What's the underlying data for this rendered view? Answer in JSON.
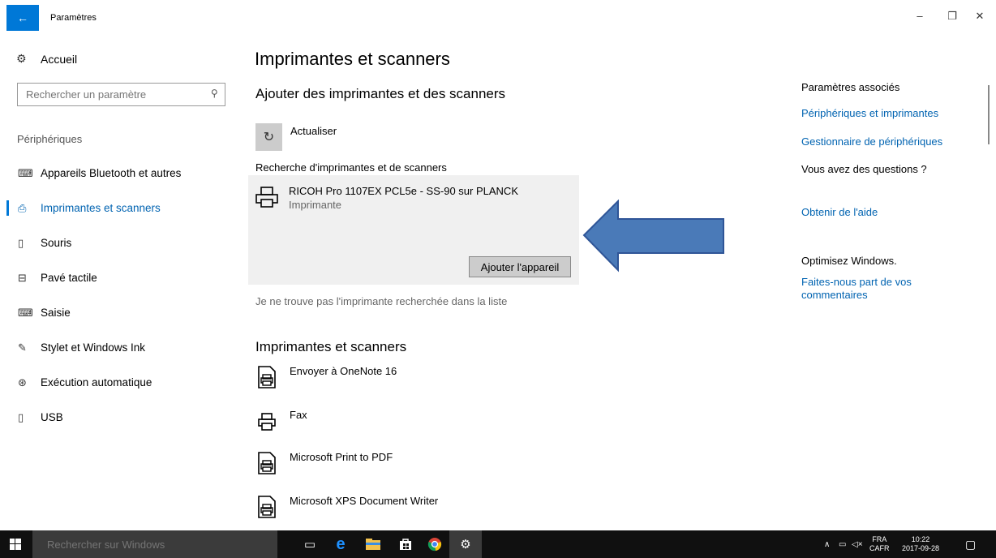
{
  "window": {
    "title": "Paramètres",
    "back_icon": "←",
    "minimize": "–",
    "restore": "❐",
    "close": "✕"
  },
  "sidebar": {
    "home_label": "Accueil",
    "search_placeholder": "Rechercher un paramètre",
    "section_label": "Périphériques",
    "items": [
      {
        "label": "Appareils Bluetooth et autres",
        "icon": "bluetooth-devices-icon",
        "glyph": "⌨"
      },
      {
        "label": "Imprimantes et scanners",
        "icon": "printer-icon",
        "glyph": "⎙"
      },
      {
        "label": "Souris",
        "icon": "mouse-icon",
        "glyph": "▯"
      },
      {
        "label": "Pavé tactile",
        "icon": "touchpad-icon",
        "glyph": "⊟"
      },
      {
        "label": "Saisie",
        "icon": "keyboard-icon",
        "glyph": "⌨"
      },
      {
        "label": "Stylet et Windows Ink",
        "icon": "pen-icon",
        "glyph": "✎"
      },
      {
        "label": "Exécution automatique",
        "icon": "autoplay-icon",
        "glyph": "⊛"
      },
      {
        "label": "USB",
        "icon": "usb-icon",
        "glyph": "▯"
      }
    ],
    "active_index": 1
  },
  "main": {
    "page_title": "Imprimantes et scanners",
    "add_section_title": "Ajouter des imprimantes et des scanners",
    "refresh_label": "Actualiser",
    "searching_text": "Recherche d'imprimantes et de scanners",
    "found_device": {
      "name": "RICOH Pro 1107EX PCL5e - SS-90 sur PLANCK",
      "type": "Imprimante",
      "add_button": "Ajouter l'appareil"
    },
    "not_found_link": "Je ne trouve pas l'imprimante recherchée dans la liste",
    "printers_section_title": "Imprimantes et scanners",
    "printers": [
      {
        "name": "Envoyer à OneNote 16",
        "icon": "document-printer-icon"
      },
      {
        "name": "Fax",
        "icon": "fax-printer-icon"
      },
      {
        "name": "Microsoft Print to PDF",
        "icon": "document-printer-icon"
      },
      {
        "name": "Microsoft XPS Document Writer",
        "icon": "document-printer-icon"
      }
    ]
  },
  "right_panel": {
    "related_heading": "Paramètres associés",
    "related_links": [
      "Périphériques et imprimantes",
      "Gestionnaire de périphériques"
    ],
    "questions_heading": "Vous avez des questions ?",
    "help_link": "Obtenir de l'aide",
    "improve_heading": "Optimisez Windows.",
    "feedback_link": "Faites-nous part de vos commentaires"
  },
  "taskbar": {
    "search_placeholder": "Rechercher sur Windows",
    "language": "FRA",
    "keyboard": "CAFR",
    "time": "10:22",
    "date": "2017-09-28"
  },
  "colors": {
    "accent": "#0078d7",
    "link": "#0063b1",
    "arrow": "#4a7ab8"
  }
}
